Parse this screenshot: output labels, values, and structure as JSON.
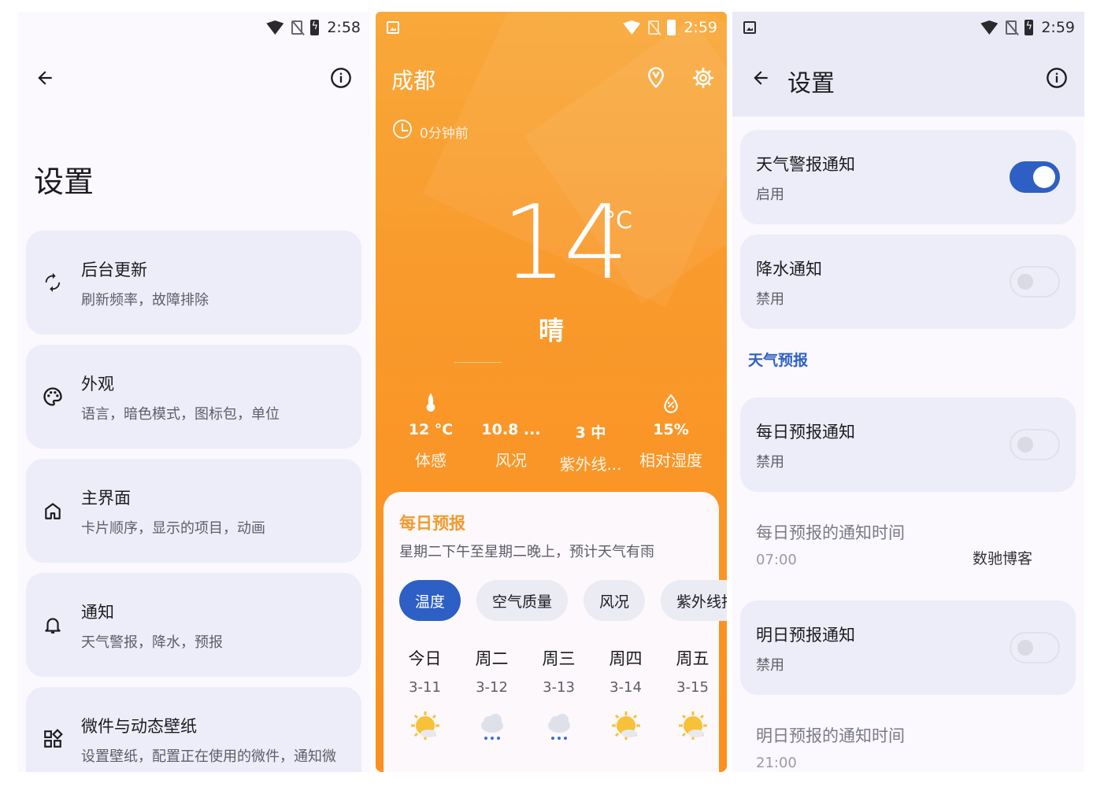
{
  "screen1": {
    "status_time": "2:58",
    "title": "设置",
    "cards": [
      {
        "title": "后台更新",
        "subtitle": "刷新频率，故障排除",
        "icon": "sync-icon"
      },
      {
        "title": "外观",
        "subtitle": "语言，暗色模式，图标包，单位",
        "icon": "palette-icon"
      },
      {
        "title": "主界面",
        "subtitle": "卡片顺序，显示的项目，动画",
        "icon": "home-icon"
      },
      {
        "title": "通知",
        "subtitle": "天气警报，降水，预报",
        "icon": "bell-icon"
      },
      {
        "title": "微件与动态壁纸",
        "subtitle": "设置壁纸，配置正在使用的微件，通知微",
        "icon": "widgets-icon"
      }
    ]
  },
  "screen2": {
    "status_time": "2:59",
    "city": "成都",
    "updated": "0分钟前",
    "temperature": "14",
    "unit": "°C",
    "condition": "晴",
    "stats": [
      {
        "value": "12 °C",
        "label": "体感",
        "icon": "thermometer-icon"
      },
      {
        "value": "10.8 ...",
        "label": "风况",
        "icon": "wind-icon"
      },
      {
        "value": "3 中",
        "label": "紫外线...",
        "icon": "uv-icon"
      },
      {
        "value": "15%",
        "label": "相对湿度",
        "icon": "humidity-icon"
      }
    ],
    "forecast": {
      "title": "每日预报",
      "description": "星期二下午至星期二晚上，预计天气有雨",
      "chips": [
        "温度",
        "空气质量",
        "风况",
        "紫外线指"
      ],
      "days": [
        {
          "name": "今日",
          "date": "3-11",
          "icon": "sun-cloud-icon"
        },
        {
          "name": "周二",
          "date": "3-12",
          "icon": "rain-icon"
        },
        {
          "name": "周三",
          "date": "3-13",
          "icon": "rain-icon"
        },
        {
          "name": "周四",
          "date": "3-14",
          "icon": "sun-cloud-icon"
        },
        {
          "name": "周五",
          "date": "3-15",
          "icon": "sun-cloud-icon"
        }
      ]
    }
  },
  "screen3": {
    "status_time": "2:59",
    "title": "设置",
    "alert": {
      "title": "天气警报通知",
      "status": "启用",
      "on": true
    },
    "precip": {
      "title": "降水通知",
      "status": "禁用",
      "on": false
    },
    "section": "天气预报",
    "daily": {
      "title": "每日预报通知",
      "status": "禁用",
      "on": false
    },
    "daily_time": {
      "title": "每日预报的通知时间",
      "value": "07:00"
    },
    "tomorrow": {
      "title": "明日预报通知",
      "status": "禁用",
      "on": false
    },
    "tomorrow_time": {
      "title": "明日预报的通知时间",
      "value": "21:00"
    },
    "watermark": "数驰博客"
  },
  "colors": {
    "accent": "#2e5fc4",
    "orange": "#f99a2c",
    "card": "#ecedf8"
  }
}
